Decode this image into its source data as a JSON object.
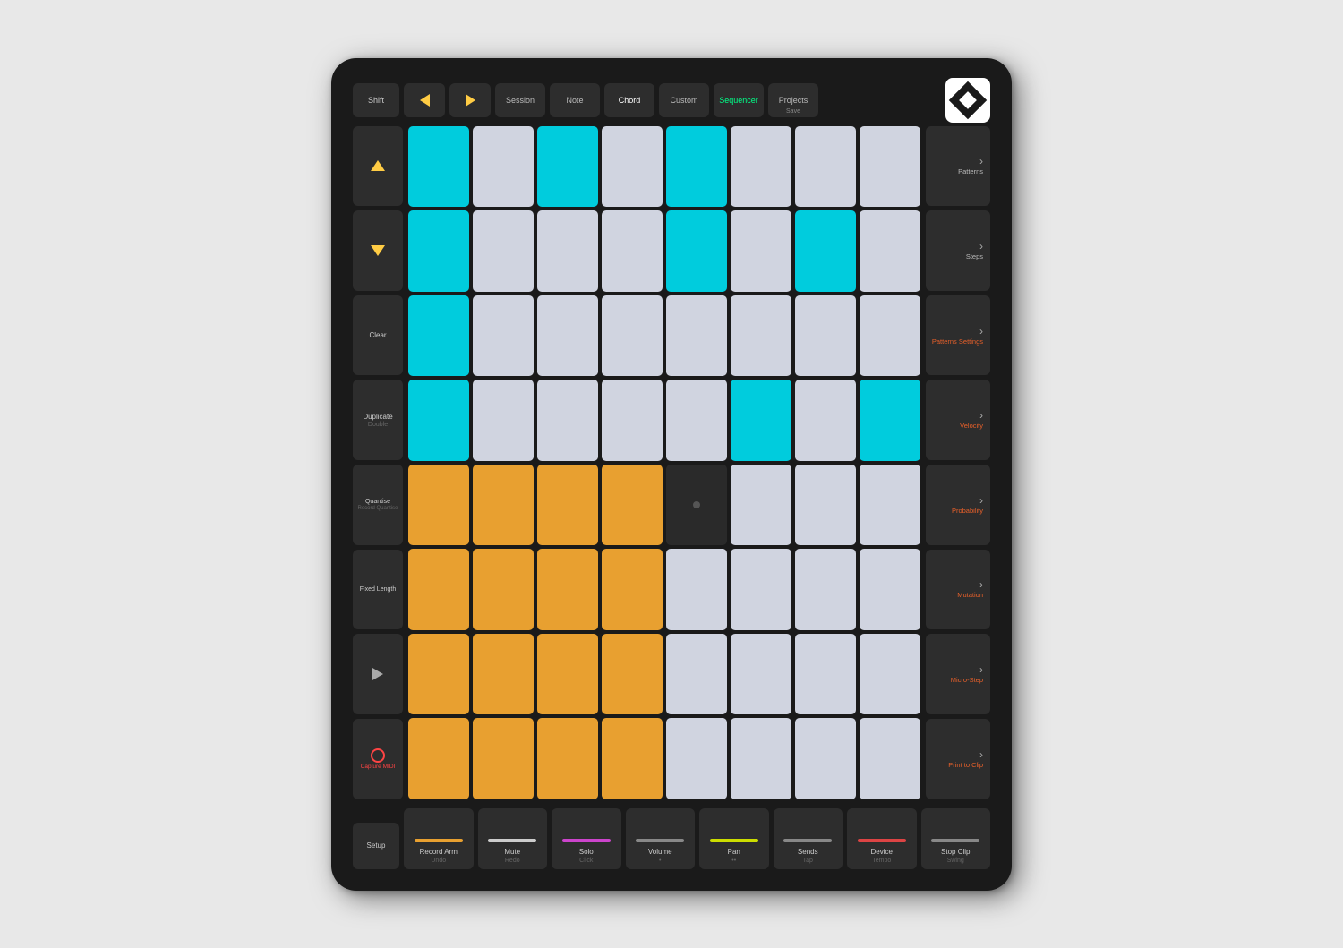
{
  "device": {
    "top_buttons": {
      "shift": "Shift",
      "left_arrow": "◄",
      "right_arrow": "►",
      "session": "Session",
      "note": "Note",
      "chord": "Chord",
      "custom": "Custom",
      "sequencer": "Sequencer",
      "projects": "Projects",
      "save": "Save"
    },
    "left_buttons": [
      {
        "label": "",
        "type": "up-arrow"
      },
      {
        "label": "",
        "type": "down-arrow"
      },
      {
        "label": "Clear",
        "sub": ""
      },
      {
        "label": "Duplicate",
        "sub": "Double"
      },
      {
        "label": "Quantise",
        "sub": "Record Quantise"
      },
      {
        "label": "Fixed Length",
        "sub": ""
      },
      {
        "label": "",
        "type": "play"
      },
      {
        "label": "",
        "type": "record",
        "sub": "Capture MIDI"
      }
    ],
    "right_buttons": [
      {
        "label": "Patterns"
      },
      {
        "label": "Steps"
      },
      {
        "label": "Patterns Settings",
        "color": "orange"
      },
      {
        "label": "Velocity",
        "color": "orange"
      },
      {
        "label": "Probability",
        "color": "orange"
      },
      {
        "label": "Mutation",
        "color": "orange"
      },
      {
        "label": "Micro-Step",
        "color": "orange"
      },
      {
        "label": "Print to Clip",
        "color": "orange"
      }
    ],
    "bottom_buttons": [
      {
        "line_color": "#e8a030",
        "main": "Record Arm",
        "sub": "Undo"
      },
      {
        "line_color": "#ffffff",
        "main": "Mute",
        "sub": "Redo"
      },
      {
        "line_color": "#cc44cc",
        "main": "Solo",
        "sub": "Click"
      },
      {
        "line_color": "#888888",
        "main": "Volume",
        "sub": "•"
      },
      {
        "line_color": "#ccdd00",
        "main": "Pan",
        "sub": "••"
      },
      {
        "line_color": "#888888",
        "main": "Sends",
        "sub": "Tap"
      },
      {
        "line_color": "#dd4444",
        "main": "Device",
        "sub": "Tempo"
      },
      {
        "line_color": "#888888",
        "main": "Stop Clip",
        "sub": "Swing"
      }
    ],
    "setup": "Setup"
  },
  "grid": {
    "rows": [
      [
        "cyan",
        "white",
        "cyan",
        "white",
        "cyan",
        "white",
        "white",
        "white"
      ],
      [
        "cyan",
        "white",
        "white",
        "white",
        "cyan",
        "white",
        "cyan",
        "white"
      ],
      [
        "cyan",
        "white",
        "white",
        "white",
        "white",
        "white",
        "white",
        "white"
      ],
      [
        "cyan",
        "white",
        "white",
        "white",
        "white",
        "cyan",
        "white",
        "cyan"
      ],
      [
        "orange",
        "orange",
        "orange",
        "orange",
        "white",
        "white",
        "white",
        "white"
      ],
      [
        "orange",
        "orange",
        "orange",
        "orange",
        "white",
        "white",
        "white",
        "white"
      ],
      [
        "orange",
        "orange",
        "orange",
        "orange",
        "white",
        "white",
        "white",
        "white"
      ],
      [
        "orange",
        "orange",
        "orange",
        "orange",
        "white",
        "white",
        "white",
        "white"
      ]
    ]
  }
}
